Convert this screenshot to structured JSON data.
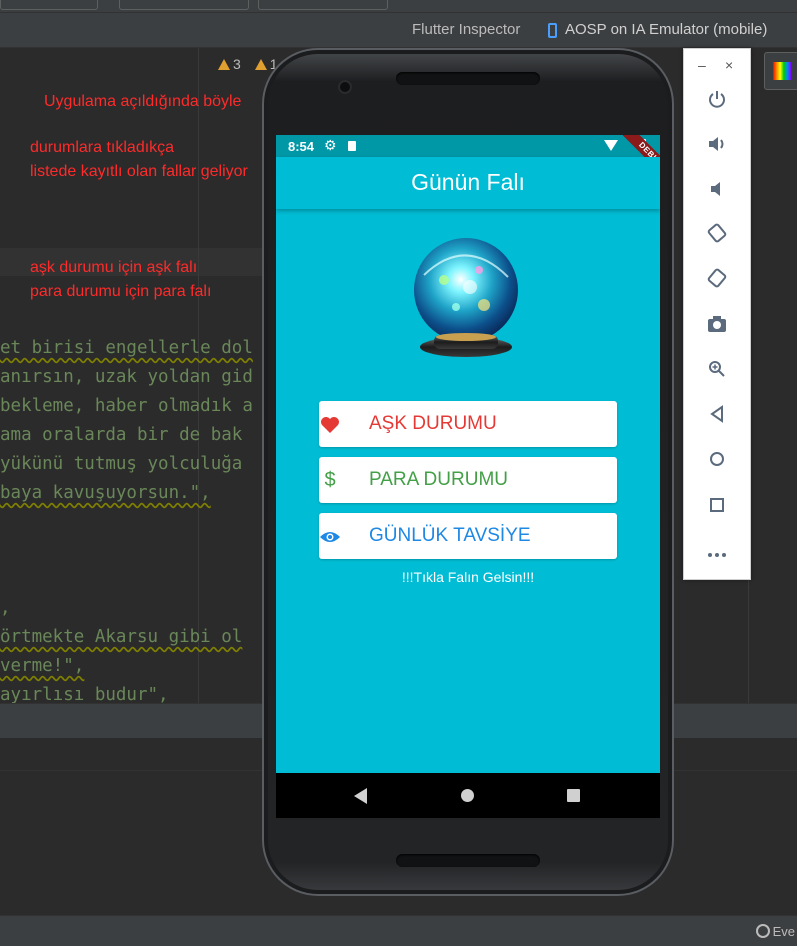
{
  "ide": {
    "tabs": {
      "flutter_inspector": "Flutter Inspector",
      "emulator_tab": "AOSP on IA Emulator (mobile)"
    },
    "warnings": {
      "warning_count": "3",
      "second_count": "1"
    },
    "status_text": "Eve",
    "annotations": {
      "line1": "Uygulama açıldığında böyle",
      "line2": "durumlara tıkladıkça",
      "line3": "listede kayıtlı olan fallar geliyor",
      "line4": "aşk durumu için aşk falı",
      "line5": "para durumu için para falı"
    },
    "code_lines": [
      "et birisi engellerle dol",
      "anırsın, uzak yoldan gid",
      "bekleme, haber olmadık a",
      "ama oralarda bir de bak",
      " yükünü tutmuş yolculuğa",
      "baya kavuşuyorsun.\",",
      ",",
      "örtmekte Akarsu gibi ol",
      "verme!\",",
      "ayırlısı budur\","
    ]
  },
  "emulator_panel": {
    "minimize": "–",
    "close": "×",
    "buttons": [
      "power-icon",
      "volume-up-icon",
      "volume-down-icon",
      "rotate-left-icon",
      "rotate-right-icon",
      "camera-icon",
      "zoom-icon",
      "back-icon",
      "home-icon",
      "overview-icon",
      "more-icon"
    ]
  },
  "phone": {
    "status_time": "8:54",
    "debug_banner": "DEBUG",
    "app_title": "Günün Falı",
    "buttons": {
      "love": {
        "label": "AŞK DURUMU",
        "color": "#e53935",
        "icon": "heart-icon"
      },
      "money": {
        "label": "PARA DURUMU",
        "color": "#43a047",
        "icon": "dollar-icon",
        "glyph": "$"
      },
      "advice": {
        "label": "GÜNLÜK TAVSİYE",
        "color": "#1e88e5",
        "icon": "eye-icon"
      }
    },
    "tap_hint": "!!!Tıkla Falın Gelsin!!!",
    "colors": {
      "background": "#00bcd4",
      "statusbar": "#0097a7"
    }
  }
}
